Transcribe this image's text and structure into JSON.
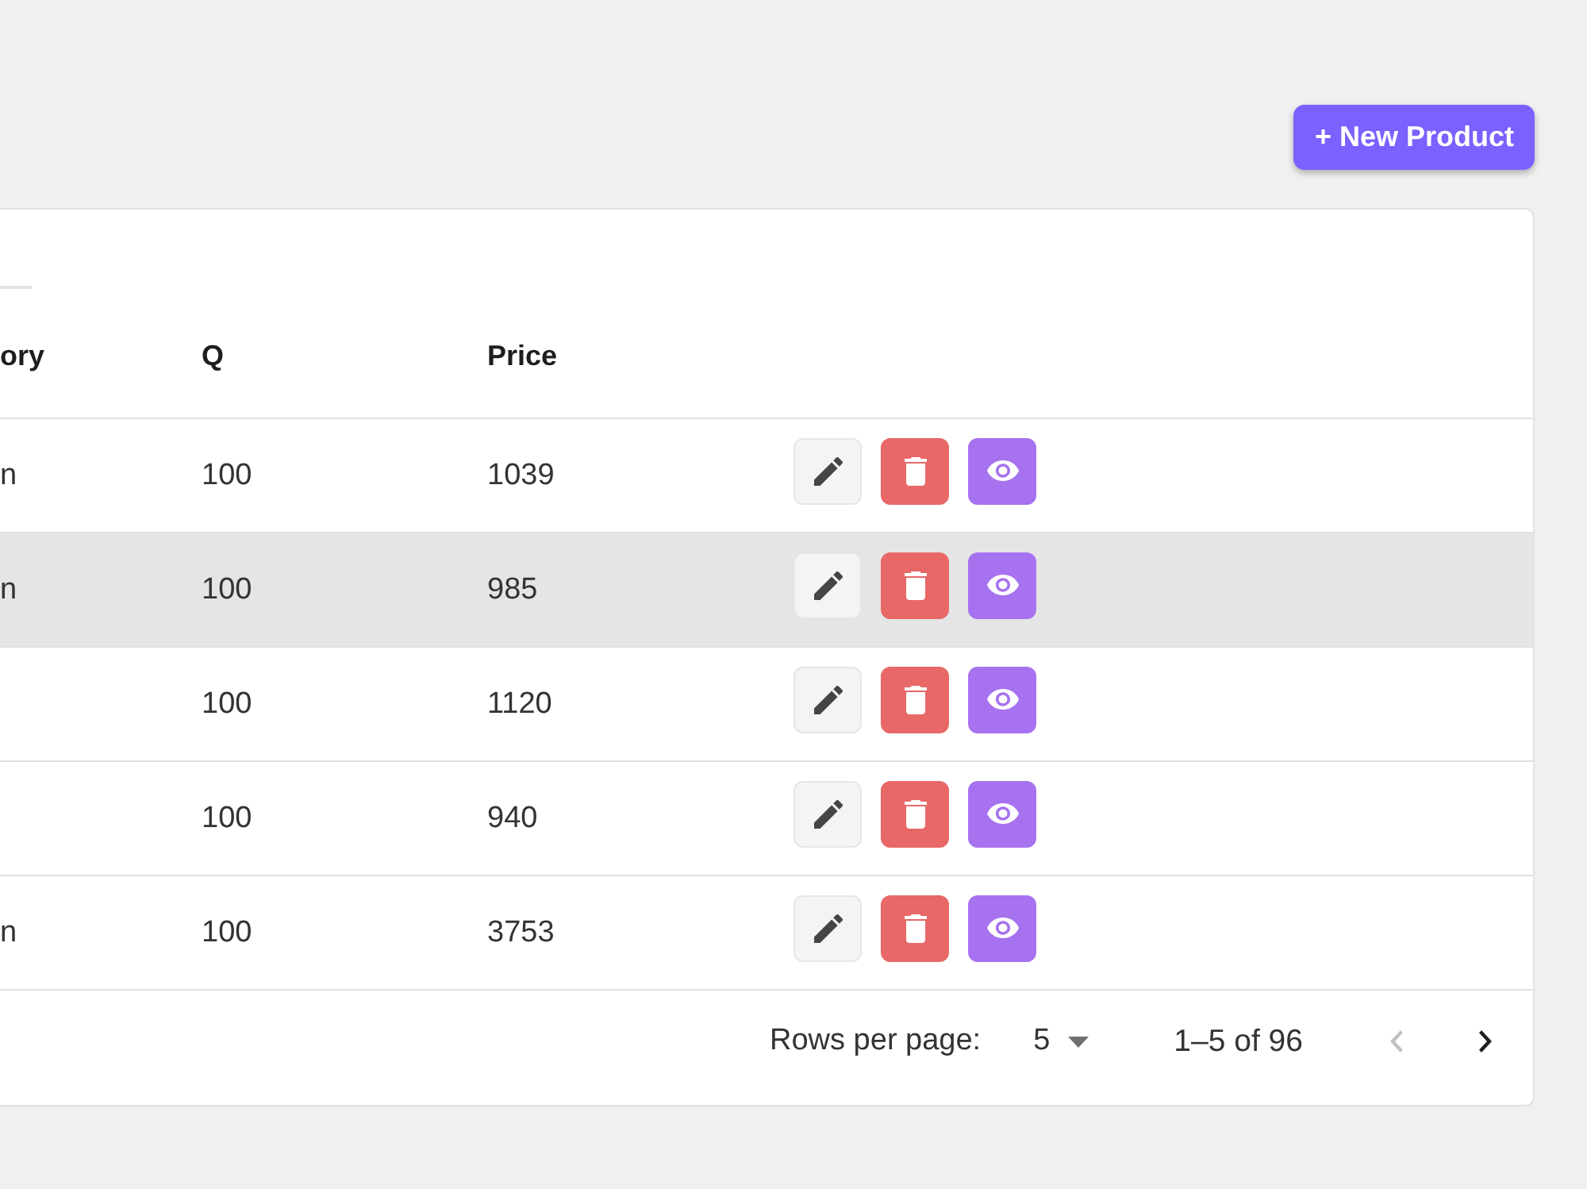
{
  "header": {
    "new_button": "+ New Product"
  },
  "table": {
    "columns": [
      {
        "label": "ory"
      },
      {
        "label": "Q"
      },
      {
        "label": "Price"
      }
    ],
    "rows": [
      {
        "column_1": "n",
        "q": "100",
        "price": "1039",
        "highlighted": false,
        "actions": [
          {
            "kind": "edit"
          },
          {
            "kind": "delete"
          },
          {
            "kind": "view"
          }
        ]
      },
      {
        "column_1": "n",
        "q": "100",
        "price": "985",
        "highlighted": true,
        "actions": [
          {
            "kind": "edit"
          },
          {
            "kind": "delete"
          },
          {
            "kind": "view"
          }
        ]
      },
      {
        "q": "100",
        "price": "1120",
        "highlighted": false,
        "actions": [
          {
            "kind": "edit"
          },
          {
            "kind": "delete"
          },
          {
            "kind": "view"
          }
        ]
      },
      {
        "q": "100",
        "price": "940",
        "highlighted": false,
        "actions": [
          {
            "kind": "edit"
          },
          {
            "kind": "delete"
          },
          {
            "kind": "view"
          }
        ]
      },
      {
        "column_1": "n",
        "q": "100",
        "price": "3753",
        "highlighted": false,
        "actions": [
          {
            "kind": "edit"
          },
          {
            "kind": "delete"
          },
          {
            "kind": "view"
          }
        ]
      }
    ]
  },
  "pagination": {
    "rows_per_page_label": "Rows per page:",
    "rows_per_page": "5",
    "range": "1–5 of 96",
    "previous": {
      "disabled": true
    },
    "next": {
      "disabled": false
    }
  }
}
